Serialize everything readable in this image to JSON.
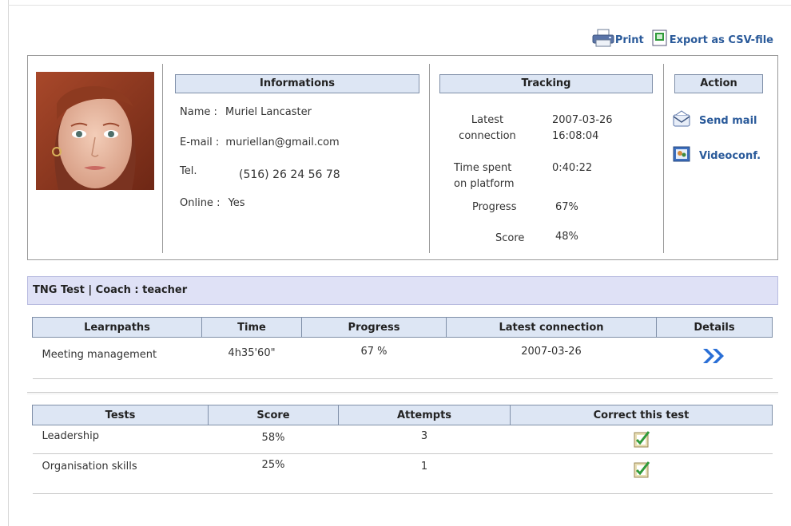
{
  "toolbar": {
    "print_label": "Print",
    "export_label": "Export as CSV-file"
  },
  "profile": {
    "informations_header": "Informations",
    "tracking_header": "Tracking",
    "action_header": "Action",
    "name_label": "Name :",
    "name_value": "Muriel Lancaster",
    "email_label": "E-mail :",
    "email_value": "muriellan@gmail.com",
    "tel_label": "Tel.",
    "tel_value": "(516) 26 24 56 78",
    "online_label": "Online :",
    "online_value": "Yes"
  },
  "tracking": {
    "latest_connection_label_1": "Latest",
    "latest_connection_label_2": "connection",
    "latest_connection_date": "2007-03-26",
    "latest_connection_time": "16:08:04",
    "time_spent_label_1": "Time spent",
    "time_spent_label_2": "on platform",
    "time_spent_value": "0:40:22",
    "progress_label": "Progress",
    "progress_value": "67%",
    "score_label": "Score",
    "score_value": "48%"
  },
  "actions": {
    "send_mail": "Send mail",
    "videoconf": "Videoconf."
  },
  "course": {
    "title": "TNG Test | Coach : teacher"
  },
  "learnpaths": {
    "headers": [
      "Learnpaths",
      "Time",
      "Progress",
      "Latest connection",
      "Details"
    ],
    "rows": [
      {
        "name": "Meeting management",
        "time": "4h35'60\"",
        "progress": "67 %",
        "latest": "2007-03-26"
      }
    ]
  },
  "tests": {
    "headers": [
      "Tests",
      "Score",
      "Attempts",
      "Correct this test"
    ],
    "rows": [
      {
        "name": "Leadership",
        "score": "58%",
        "attempts": "3"
      },
      {
        "name": "Organisation skills",
        "score": "25%",
        "attempts": "1"
      }
    ]
  },
  "colors": {
    "link": "#2a5a9a",
    "header_bg": "#dde6f4",
    "course_bar_bg": "#dfe1f6",
    "details_arrow": "#2a6fd6"
  },
  "icons": [
    "printer-icon",
    "csv-export-icon",
    "mail-icon",
    "videoconf-icon",
    "details-arrow-icon",
    "correct-test-icon"
  ]
}
